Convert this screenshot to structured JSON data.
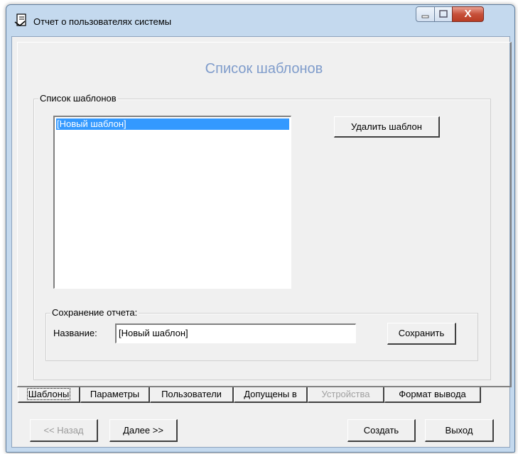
{
  "window": {
    "title": "Отчет о пользователях системы",
    "close_label": "X"
  },
  "page": {
    "heading": "Список шаблонов"
  },
  "templates_group": {
    "legend": "Список шаблонов",
    "items": [
      "[Новый шаблон]"
    ],
    "selected_index": 0,
    "delete_button": "Удалить шаблон"
  },
  "save_group": {
    "legend": "Сохранение отчета:",
    "name_label": "Название:",
    "name_value": "[Новый шаблон]",
    "save_button": "Сохранить"
  },
  "tabs": [
    {
      "label": "Шаблоны",
      "active": true,
      "enabled": true
    },
    {
      "label": "Параметры",
      "active": false,
      "enabled": true
    },
    {
      "label": "Пользователи",
      "active": false,
      "enabled": true
    },
    {
      "label": "Допущены в",
      "active": false,
      "enabled": true
    },
    {
      "label": "Устройства",
      "active": false,
      "enabled": false
    },
    {
      "label": "Формат вывода",
      "active": false,
      "enabled": true
    }
  ],
  "footer": {
    "back_button": "<< Назад",
    "next_button": "Далее >>",
    "create_button": "Создать",
    "exit_button": "Выход"
  },
  "colors": {
    "heading": "#7f9ccb",
    "selection": "#3399ff",
    "frame": "#c4d9ee"
  }
}
